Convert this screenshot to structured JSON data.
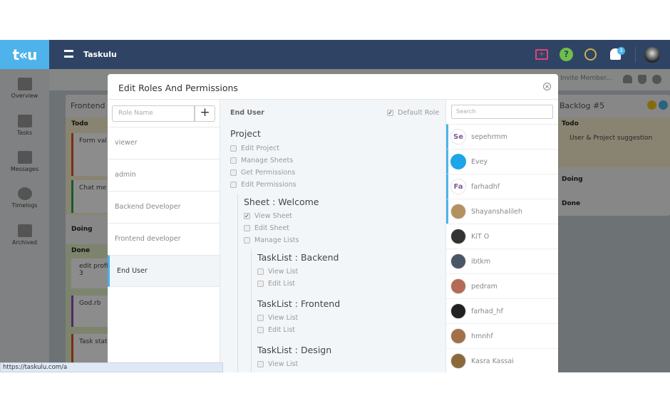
{
  "header": {
    "logo": "t«u",
    "app_title": "Taskulu",
    "notification_count": "3",
    "colors": {
      "header": "#2f4465",
      "logo_bg": "#4db3ea",
      "accent": "#4db3ea"
    }
  },
  "sidebar": {
    "items": [
      {
        "label": "Overview",
        "icon": "grid-icon"
      },
      {
        "label": "Tasks",
        "icon": "tasks-icon"
      },
      {
        "label": "Messages",
        "icon": "chat-icon"
      },
      {
        "label": "Timelogs",
        "icon": "clock-icon"
      },
      {
        "label": "Archived",
        "icon": "archive-icon"
      }
    ]
  },
  "subbar": {
    "invite_placeholder": "Invite Member..."
  },
  "boards": {
    "frontend": {
      "title": "Frontend",
      "todo": "Todo",
      "doing": "Doing",
      "done": "Done",
      "cards": [
        "Form val",
        "Chat me",
        "edit profil",
        "God.rb",
        "Task stat"
      ],
      "attachments": "3"
    },
    "backlog": {
      "title": "Backlog #5",
      "todo": "Todo",
      "doing": "Doing",
      "done": "Done",
      "cards": [
        "User & Project suggestion"
      ]
    }
  },
  "modal": {
    "title": "Edit Roles And Permissions",
    "role_name_placeholder": "Role Name",
    "add_label": "+",
    "roles": [
      "viewer",
      "admin",
      "Backend Developer",
      "Frontend developer",
      "End User"
    ],
    "selected_role": "End User",
    "default_role_label": "Default Role",
    "default_role_checked": true,
    "project": {
      "title": "Project",
      "perms": [
        {
          "label": "Edit Project",
          "checked": false
        },
        {
          "label": "Manage Sheets",
          "checked": false
        },
        {
          "label": "Get Permissions",
          "checked": false
        },
        {
          "label": "Edit Permissions",
          "checked": false
        }
      ]
    },
    "sheet": {
      "title": "Sheet : Welcome",
      "perms": [
        {
          "label": "View Sheet",
          "checked": true
        },
        {
          "label": "Edit Sheet",
          "checked": false
        },
        {
          "label": "Manage Lists",
          "checked": false
        }
      ]
    },
    "tasklists": [
      {
        "title": "TaskList : Backend",
        "perms": [
          {
            "label": "View List",
            "checked": false
          },
          {
            "label": "Edit List",
            "checked": false
          }
        ]
      },
      {
        "title": "TaskList : Frontend",
        "perms": [
          {
            "label": "View List",
            "checked": false
          },
          {
            "label": "Edit List",
            "checked": false
          }
        ]
      },
      {
        "title": "TaskList : Design",
        "perms": [
          {
            "label": "View List",
            "checked": false
          }
        ]
      }
    ],
    "search_placeholder": "Search",
    "users": [
      {
        "name": "sepehrmm",
        "initials": "Se",
        "highlight": true
      },
      {
        "name": "Evey",
        "highlight": true
      },
      {
        "name": "farhadhf",
        "initials": "Fa",
        "highlight": true
      },
      {
        "name": "Shayanshalileh",
        "highlight": true
      },
      {
        "name": "KiT O"
      },
      {
        "name": "ibtkm"
      },
      {
        "name": "pedram"
      },
      {
        "name": "farhad_hf"
      },
      {
        "name": "hmnhf"
      },
      {
        "name": "Kasra Kassai"
      }
    ]
  },
  "status_bar": {
    "url": "https://taskulu.com/a"
  }
}
